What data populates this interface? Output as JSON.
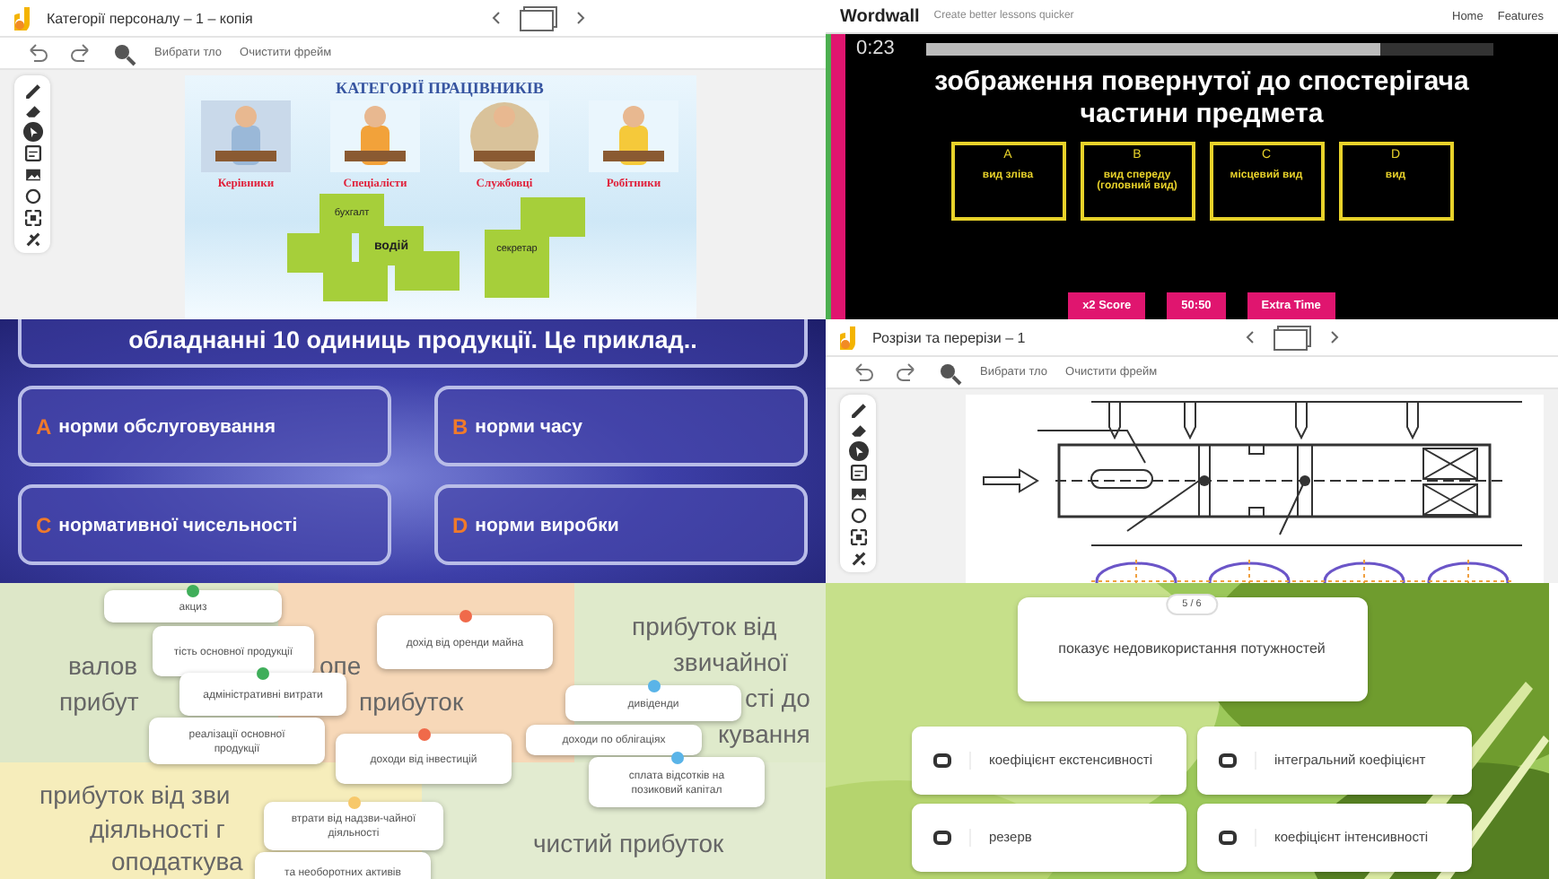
{
  "jamboard_personnel": {
    "title": "Категорії персоналу – 1 – копія",
    "toolbar": [
      "Вибрати тло",
      "Очистити фрейм"
    ],
    "slide": {
      "heading": "КАТЕГОРІЇ ПРАЦІВНИКІВ",
      "categories": [
        "Керівники",
        "Спеціалісти",
        "Службовці",
        "Робітники"
      ],
      "notes": [
        "бухгалт",
        "водій",
        "секретар"
      ]
    }
  },
  "wordwall_quiz": {
    "brand": "Wordwall",
    "tagline": "Create better lessons quicker",
    "nav": [
      "Home",
      "Features"
    ],
    "timer": "0:23",
    "progress": {
      "level": 0.8
    },
    "question": "зображення повернутої до спостерігача частини предмета",
    "answers": [
      {
        "letter": "A",
        "text": "вид зліва"
      },
      {
        "letter": "B",
        "text": "вид спереду (головний вид)"
      },
      {
        "letter": "C",
        "text": "місцевий вид"
      },
      {
        "letter": "D",
        "text": "вид"
      }
    ],
    "powerups": [
      "x2 Score",
      "50:50",
      "Extra Time"
    ]
  },
  "norms_quiz": {
    "question": "обладнанні 10 одиниць продукції. Це приклад..",
    "answers": [
      {
        "letter": "A",
        "text": "норми обслуговування"
      },
      {
        "letter": "B",
        "text": "норми часу"
      },
      {
        "letter": "C",
        "text": "нормативної чисельності"
      },
      {
        "letter": "D",
        "text": "норми виробки"
      }
    ]
  },
  "jamboard_sections": {
    "title": "Розрізи та перерізи – 1",
    "toolbar": [
      "Вибрати тло",
      "Очистити фрейм"
    ]
  },
  "group_sort": {
    "labels": [
      "валов",
      "прибут",
      "опе",
      "прибуток",
      "прибуток від",
      "звичайної",
      "сті до",
      "кування",
      "прибуток від зви",
      "діяльності г",
      "оподаткува",
      "чистий прибуток"
    ],
    "cards": [
      {
        "text": "акциз",
        "color": "#3fae5a"
      },
      {
        "text": "тість основної продукції"
      },
      {
        "text": "адміністративні витрати",
        "color": "#3fae5a"
      },
      {
        "text": "реалізації основної продукції"
      },
      {
        "text": "дохід від оренди майна",
        "color": "#f06a4a"
      },
      {
        "text": "дивіденди",
        "color": "#5ab4e8"
      },
      {
        "text": "доходи по облігаціях"
      },
      {
        "text": "доходи від інвестицій",
        "color": "#f06a4a"
      },
      {
        "text": "сплата відсотків на позиковий капітал",
        "color": "#5ab4e8"
      },
      {
        "text": "втрати від надзви-чайної діяльності",
        "color": "#f7c86a"
      },
      {
        "text": "та необоротних активів"
      }
    ]
  },
  "capacity_quiz": {
    "counter": "5 / 6",
    "question": "показує недовикористання потужностей",
    "answers": [
      "коефіцієнт екстенсивності",
      "інтегральний коефіцієнт",
      "резерв",
      "коефіцієнт інтенсивності"
    ]
  }
}
